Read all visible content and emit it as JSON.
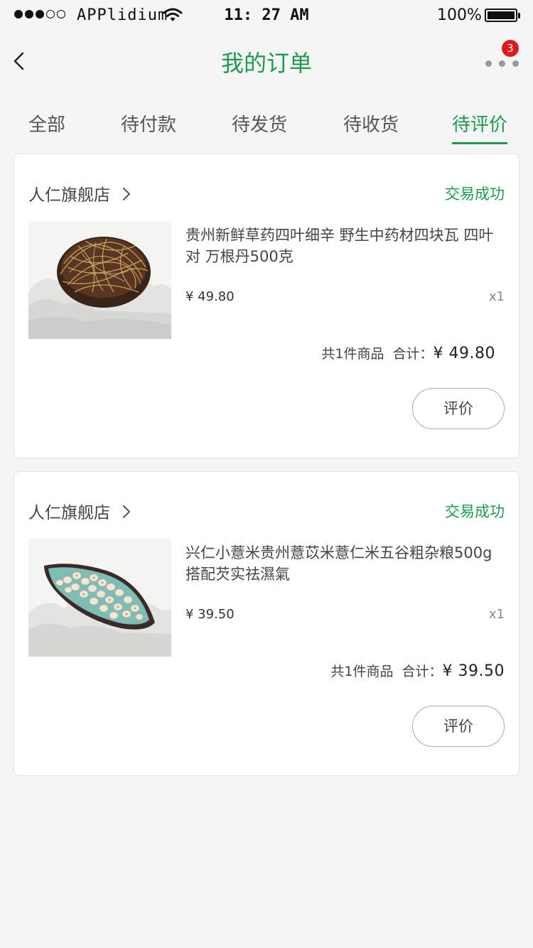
{
  "status_bar": {
    "carrier": "APPlidium",
    "time": "11: 27 AM",
    "battery": "100%",
    "icons": [
      "signal-dots-icon",
      "wifi-icon",
      "battery-icon"
    ]
  },
  "nav": {
    "title": "我的订单",
    "back_icon": "chevron-left-icon",
    "more_icon": "more-dots-icon",
    "badge_count": "3"
  },
  "tabs": [
    {
      "label": "全部",
      "active": false
    },
    {
      "label": "待付款",
      "active": false
    },
    {
      "label": "待发货",
      "active": false
    },
    {
      "label": "待收货",
      "active": false
    },
    {
      "label": "待评价",
      "active": true
    }
  ],
  "orders": [
    {
      "shop": "人仁旗舰店",
      "status": "交易成功",
      "product_title": "贵州新鲜草药四叶细辛 野生中药材四块瓦 四叶对 万根丹500克",
      "price": "¥ 49.80",
      "qty": "x1",
      "count_text": "共1件商品",
      "total_label": "合计：",
      "total": "¥ 49.80",
      "action": "评价"
    },
    {
      "shop": "人仁旗舰店",
      "status": "交易成功",
      "product_title": "兴仁小薏米贵州薏苡米薏仁米五谷粗杂粮500g 搭配芡实祛濕氣",
      "price": "¥ 39.50",
      "qty": "x1",
      "count_text": "共1件商品",
      "total_label": "合计：",
      "total": "¥ 39.50",
      "action": "评价"
    }
  ],
  "colors": {
    "accent": "#1e9a4f",
    "badge": "#e0191a",
    "background": "#f5f5f5"
  }
}
